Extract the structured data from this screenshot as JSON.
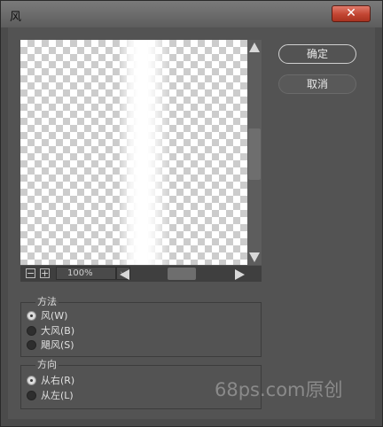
{
  "window": {
    "title": "风",
    "close_glyph": "✕"
  },
  "buttons": {
    "ok": "确定",
    "cancel": "取消"
  },
  "preview": {
    "zoom_out": "−",
    "zoom_in": "+",
    "zoom_value": "100%",
    "zoom_dropdown_glyph": "⌵"
  },
  "method": {
    "legend": "方法",
    "options": [
      {
        "label": "风(W)",
        "selected": true
      },
      {
        "label": "大风(B)",
        "selected": false
      },
      {
        "label": "飓风(S)",
        "selected": false
      }
    ]
  },
  "direction": {
    "legend": "方向",
    "options": [
      {
        "label": "从右(R)",
        "selected": true
      },
      {
        "label": "从左(L)",
        "selected": false
      }
    ]
  },
  "watermark": "68ps.com原创",
  "icons": [
    "close-icon",
    "zoom-out-icon",
    "zoom-in-icon",
    "chevron-down-icon",
    "arrow-up-icon",
    "arrow-down-icon",
    "arrow-left-icon",
    "arrow-right-icon"
  ],
  "colors": {
    "dialog_bg": "#535353",
    "close_button": "#c24532",
    "accent_text": "#e8e8e8"
  }
}
